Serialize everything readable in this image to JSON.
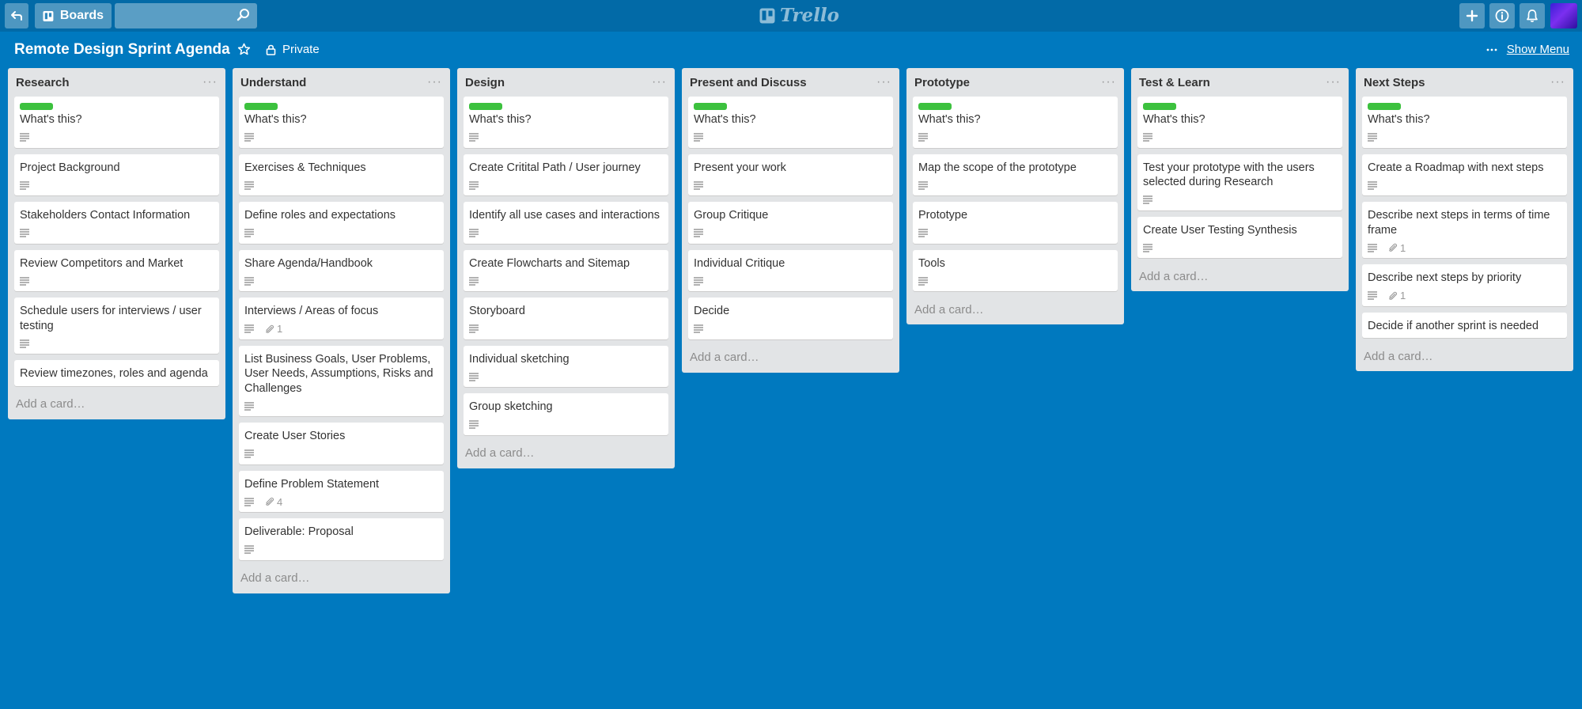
{
  "header": {
    "boards_label": "Boards",
    "search_value": "",
    "logo_text": "Trello"
  },
  "board": {
    "title": "Remote Design Sprint Agenda",
    "privacy": "Private",
    "show_menu": "Show Menu"
  },
  "colors": {
    "background": "#0079bf",
    "header": "#026aa7",
    "label_green": "#3cc13e",
    "list_bg": "#e2e4e6"
  },
  "add_card_label": "Add a card…",
  "lists": [
    {
      "title": "Research",
      "cards": [
        {
          "title": "What's this?",
          "label": "green",
          "description": true
        },
        {
          "title": "Project Background",
          "description": true
        },
        {
          "title": "Stakeholders Contact Information",
          "description": true
        },
        {
          "title": "Review Competitors and Market",
          "description": true
        },
        {
          "title": "Schedule users for interviews / user testing",
          "description": true
        },
        {
          "title": "Review timezones, roles and agenda",
          "description": false
        }
      ]
    },
    {
      "title": "Understand",
      "cards": [
        {
          "title": "What's this?",
          "label": "green",
          "description": true
        },
        {
          "title": "Exercises & Techniques",
          "description": true
        },
        {
          "title": "Define roles and expectations",
          "description": true
        },
        {
          "title": "Share Agenda/Handbook",
          "description": true
        },
        {
          "title": "Interviews / Areas of focus",
          "description": true,
          "attachments": "1"
        },
        {
          "title": "List Business Goals, User Problems, User Needs, Assumptions, Risks and Challenges",
          "description": true
        },
        {
          "title": "Create User Stories",
          "description": true
        },
        {
          "title": "Define Problem Statement",
          "description": true,
          "attachments": "4"
        },
        {
          "title": "Deliverable: Proposal",
          "description": true
        }
      ]
    },
    {
      "title": "Design",
      "cards": [
        {
          "title": "What's this?",
          "label": "green",
          "description": true
        },
        {
          "title": "Create Critital Path / User journey",
          "description": true
        },
        {
          "title": "Identify all use cases and interactions",
          "description": true
        },
        {
          "title": "Create Flowcharts and Sitemap",
          "description": true
        },
        {
          "title": "Storyboard",
          "description": true
        },
        {
          "title": "Individual sketching",
          "description": true
        },
        {
          "title": "Group sketching",
          "description": true
        }
      ]
    },
    {
      "title": "Present and Discuss",
      "cards": [
        {
          "title": "What's this?",
          "label": "green",
          "description": true
        },
        {
          "title": "Present your work",
          "description": true
        },
        {
          "title": "Group Critique",
          "description": true
        },
        {
          "title": "Individual Critique",
          "description": true
        },
        {
          "title": "Decide",
          "description": true
        }
      ]
    },
    {
      "title": "Prototype",
      "cards": [
        {
          "title": "What's this?",
          "label": "green",
          "description": true
        },
        {
          "title": "Map the scope of the prototype",
          "description": true
        },
        {
          "title": "Prototype",
          "description": true
        },
        {
          "title": "Tools",
          "description": true
        }
      ]
    },
    {
      "title": "Test & Learn",
      "cards": [
        {
          "title": "What's this?",
          "label": "green",
          "description": true
        },
        {
          "title": "Test your prototype with the users selected during Research",
          "description": true
        },
        {
          "title": "Create User Testing Synthesis",
          "description": true
        }
      ]
    },
    {
      "title": "Next Steps",
      "cards": [
        {
          "title": "What's this?",
          "label": "green",
          "description": true
        },
        {
          "title": "Create a Roadmap with next steps",
          "description": true
        },
        {
          "title": "Describe next steps in terms of time frame",
          "description": true,
          "attachments": "1"
        },
        {
          "title": "Describe next steps by priority",
          "description": true,
          "attachments": "1"
        },
        {
          "title": "Decide if another sprint is needed",
          "description": false
        }
      ]
    }
  ]
}
